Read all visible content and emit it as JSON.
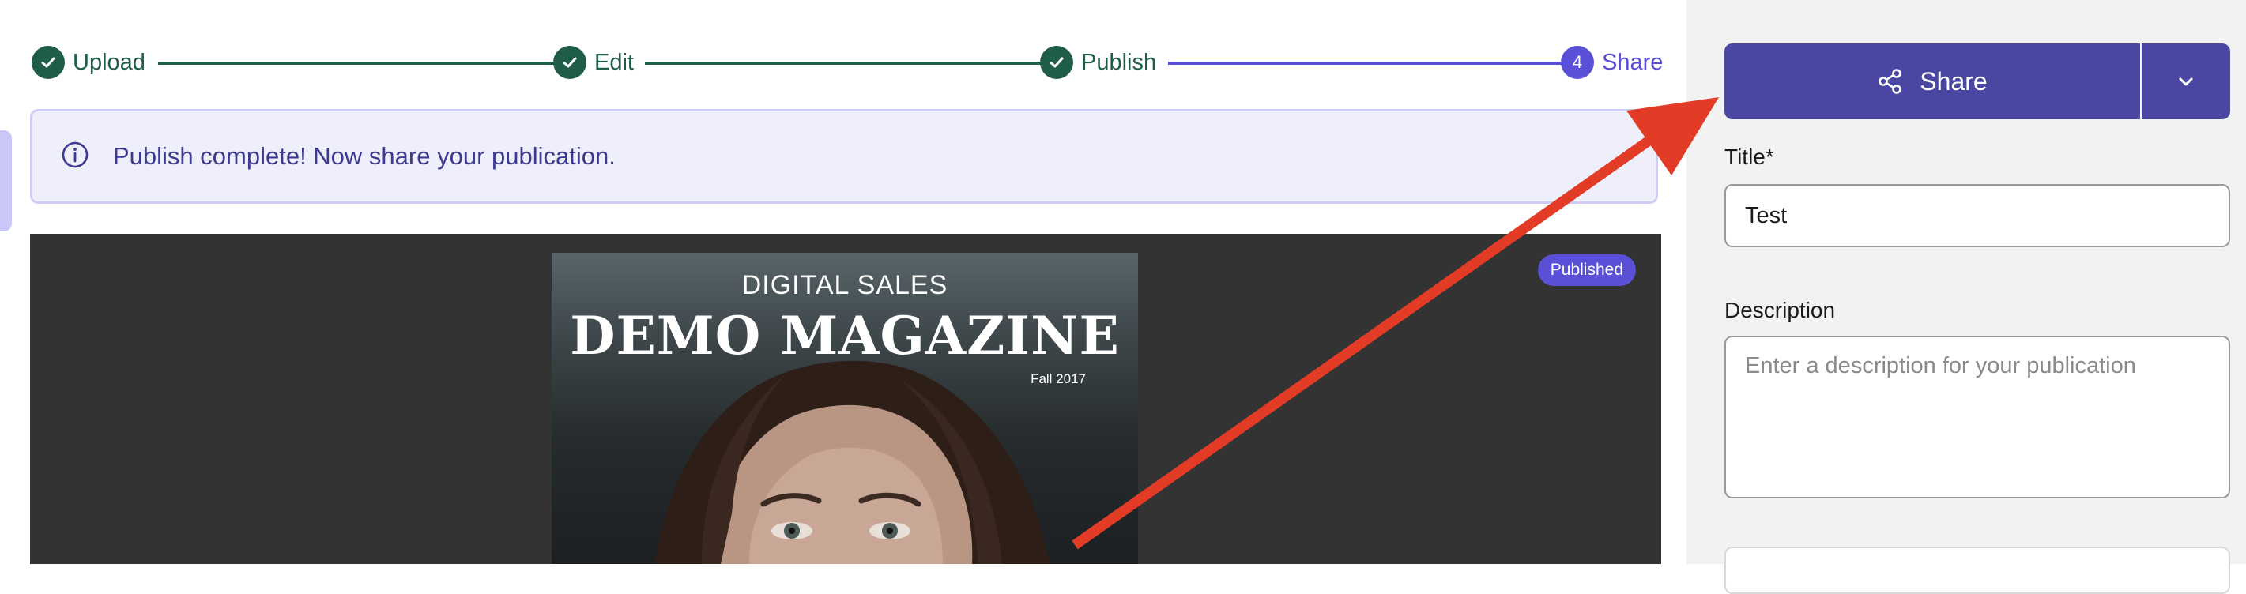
{
  "stepper": {
    "steps": [
      {
        "label": "Upload",
        "state": "done",
        "icon": "check-icon"
      },
      {
        "label": "Edit",
        "state": "done",
        "icon": "check-icon"
      },
      {
        "label": "Publish",
        "state": "done",
        "icon": "check-icon"
      },
      {
        "label": "Share",
        "number": "4",
        "state": "current"
      }
    ]
  },
  "banner": {
    "icon": "info-icon",
    "message": "Publish complete! Now share your publication."
  },
  "preview": {
    "badge": "Published",
    "cover": {
      "kicker": "DIGITAL SALES",
      "masthead": "DEMO MAGAZINE",
      "issue": "Fall 2017"
    }
  },
  "sidebar": {
    "share_button": {
      "label": "Share",
      "icon": "share-icon"
    },
    "share_menu_icon": "chevron-down-icon",
    "title_label": "Title*",
    "title_value": "Test",
    "description_label": "Description",
    "description_placeholder": "Enter a description for your publication"
  },
  "colors": {
    "accent": "#5a50d8",
    "share_button": "#4a47a3",
    "done_green": "#1f5c4a",
    "banner_bg": "#efeffc",
    "annotation_arrow": "#e23b26"
  }
}
